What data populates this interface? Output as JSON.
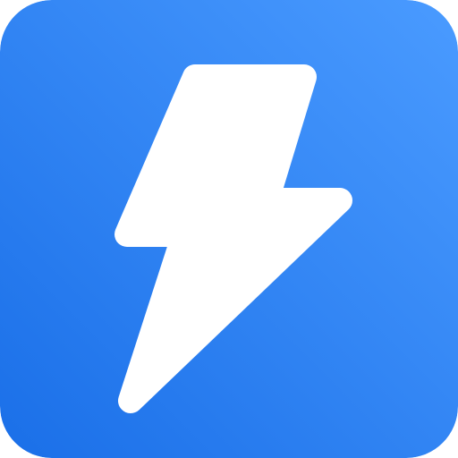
{
  "icon": {
    "name": "lightning-bolt-app-icon",
    "glyph": "lightning-bolt-icon",
    "colors": {
      "gradient_start": "#4a9bff",
      "gradient_end": "#1a6fe8",
      "glyph": "#ffffff"
    }
  }
}
